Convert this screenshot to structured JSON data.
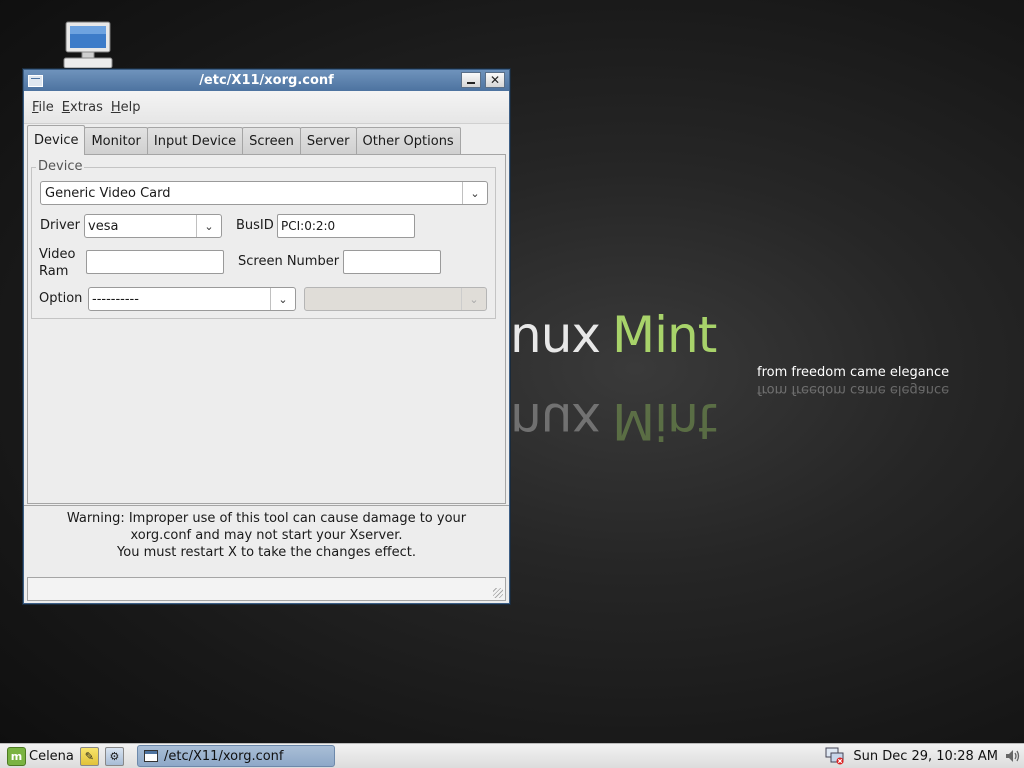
{
  "desktop": {
    "wallpaper": {
      "logo_linux": "nux",
      "logo_mint": "Mint",
      "tagline": "from freedom came elegance"
    },
    "icons": [
      {
        "icon": "computer-icon"
      }
    ]
  },
  "window": {
    "title": "/etc/X11/xorg.conf",
    "controls": {
      "menu_icon": "window-menu-icon",
      "minimize_icon": "minimize-icon",
      "close_icon": "close-icon"
    },
    "menubar": [
      {
        "label": "File",
        "mnemonic": "F"
      },
      {
        "label": "Extras",
        "mnemonic": "E"
      },
      {
        "label": "Help",
        "mnemonic": "H"
      }
    ],
    "tabs": [
      {
        "label": "Device",
        "active": true
      },
      {
        "label": "Monitor",
        "active": false
      },
      {
        "label": "Input Device",
        "active": false
      },
      {
        "label": "Screen",
        "active": false
      },
      {
        "label": "Server",
        "active": false
      },
      {
        "label": "Other Options",
        "active": false
      }
    ],
    "device_frame": {
      "label": "Device",
      "device_combo": {
        "value": "Generic Video Card"
      },
      "driver": {
        "label": "Driver",
        "value": "vesa"
      },
      "busid": {
        "label": "BusID",
        "value": "PCI:0:2:0"
      },
      "video_ram": {
        "label_line1": "Video",
        "label_line2": "Ram",
        "value": ""
      },
      "screen_number": {
        "label": "Screen Number",
        "value": ""
      },
      "option": {
        "label": "Option",
        "value": "----------",
        "value_combo_enabled": false,
        "value_combo_value": ""
      }
    },
    "warning": {
      "line1": "Warning: Improper use of this tool can cause damage to your",
      "line2": "xorg.conf and may not start your Xserver.",
      "line3": "You must restart X to take the changes effect."
    },
    "statusbar": {
      "text": ""
    }
  },
  "taskbar": {
    "start_label": "Celena",
    "quick_launch": [
      {
        "icon": "notes-icon"
      },
      {
        "icon": "preferences-icon"
      }
    ],
    "tasks": [
      {
        "label": "/etc/X11/xorg.conf",
        "active": true
      }
    ],
    "tray": {
      "network_icon": "network-disconnected-icon",
      "clock": "Sun Dec 29, 10:28 AM",
      "volume_icon": "volume-icon"
    }
  },
  "colors": {
    "titlebar": "#5b80ac",
    "mint_green": "#a8d36a",
    "task_active": "#9bb3cf"
  }
}
